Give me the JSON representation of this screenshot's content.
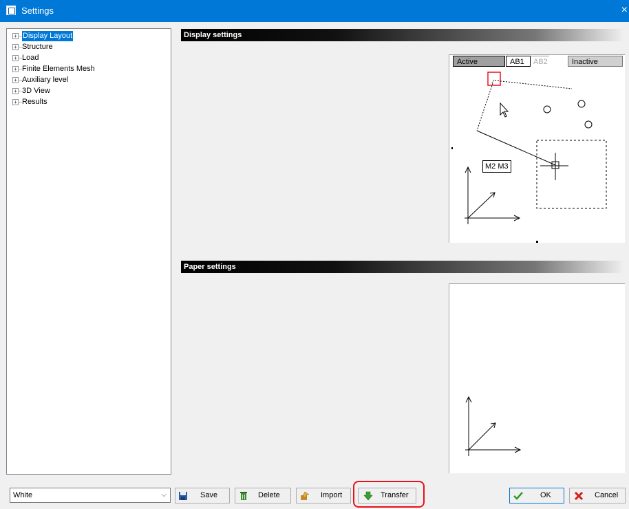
{
  "window": {
    "title": "Settings",
    "close_glyph": "×"
  },
  "tree": {
    "items": [
      {
        "label": "Display Layout",
        "selected": true
      },
      {
        "label": "Structure"
      },
      {
        "label": "Load"
      },
      {
        "label": "Finite Elements Mesh"
      },
      {
        "label": "Auxiliary level"
      },
      {
        "label": "3D View"
      },
      {
        "label": "Results"
      }
    ],
    "expand_glyph": "+"
  },
  "display": {
    "header": "Display settings",
    "tabs": {
      "active": "Active",
      "ab1": "AB1",
      "ab2": "AB2",
      "inactive": "Inactive"
    },
    "annotation": "M2 M3"
  },
  "paper": {
    "header": "Paper settings"
  },
  "footer": {
    "scheme_value": "White",
    "buttons": {
      "save": "Save",
      "delete": "Delete",
      "import": "Import",
      "transfer": "Transfer",
      "ok": "OK",
      "cancel": "Cancel"
    }
  },
  "colors": {
    "accent": "#0078d7",
    "highlight_ring": "#e8111d",
    "marker": "#e81123"
  }
}
